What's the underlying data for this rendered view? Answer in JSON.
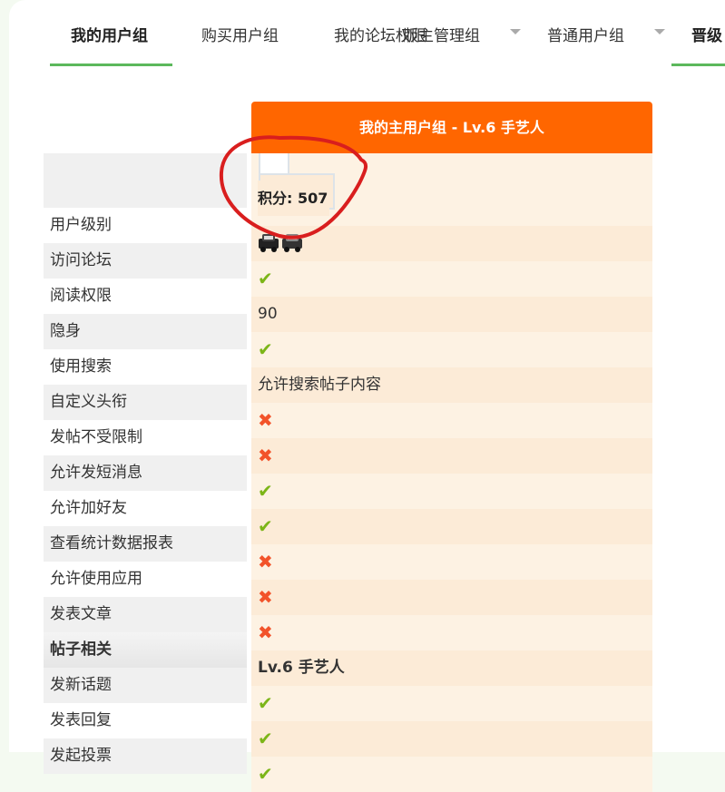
{
  "tabs": [
    {
      "label": "我的用户组",
      "active": true
    },
    {
      "label": "购买用户组"
    },
    {
      "label": "我的论坛权限"
    },
    {
      "label": "版主管理组"
    },
    {
      "label": "普通用户组"
    },
    {
      "label": "晋级"
    }
  ],
  "header": {
    "title": "我的主用户组 - Lv.6 手艺人"
  },
  "points": {
    "label": "积分: 507"
  },
  "rows": [
    {
      "label": "用户级别",
      "value_type": "icon",
      "icon": "level-car-icon"
    },
    {
      "label": "访问论坛",
      "value_type": "check"
    },
    {
      "label": "阅读权限",
      "value_type": "text",
      "value": "90"
    },
    {
      "label": "隐身",
      "value_type": "check"
    },
    {
      "label": "使用搜索",
      "value_type": "text",
      "value": "允许搜索帖子内容"
    },
    {
      "label": "自定义头衔",
      "value_type": "cross"
    },
    {
      "label": "发帖不受限制",
      "value_type": "cross"
    },
    {
      "label": "允许发短消息",
      "value_type": "check"
    },
    {
      "label": "允许加好友",
      "value_type": "check"
    },
    {
      "label": "查看统计数据报表",
      "value_type": "cross"
    },
    {
      "label": "允许使用应用",
      "value_type": "cross"
    },
    {
      "label": "发表文章",
      "value_type": "cross"
    },
    {
      "label": "帖子相关",
      "section": true,
      "value_type": "text",
      "value": "Lv.6 手艺人"
    },
    {
      "label": "发新话题",
      "value_type": "check"
    },
    {
      "label": "发表回复",
      "value_type": "check"
    },
    {
      "label": "发起投票",
      "value_type": "check"
    }
  ],
  "colors": {
    "accent": "#ff6600",
    "tab_active": "#5cb85c",
    "check": "#7cb518",
    "cross": "#f2532a",
    "annotation": "#d91e1e"
  }
}
